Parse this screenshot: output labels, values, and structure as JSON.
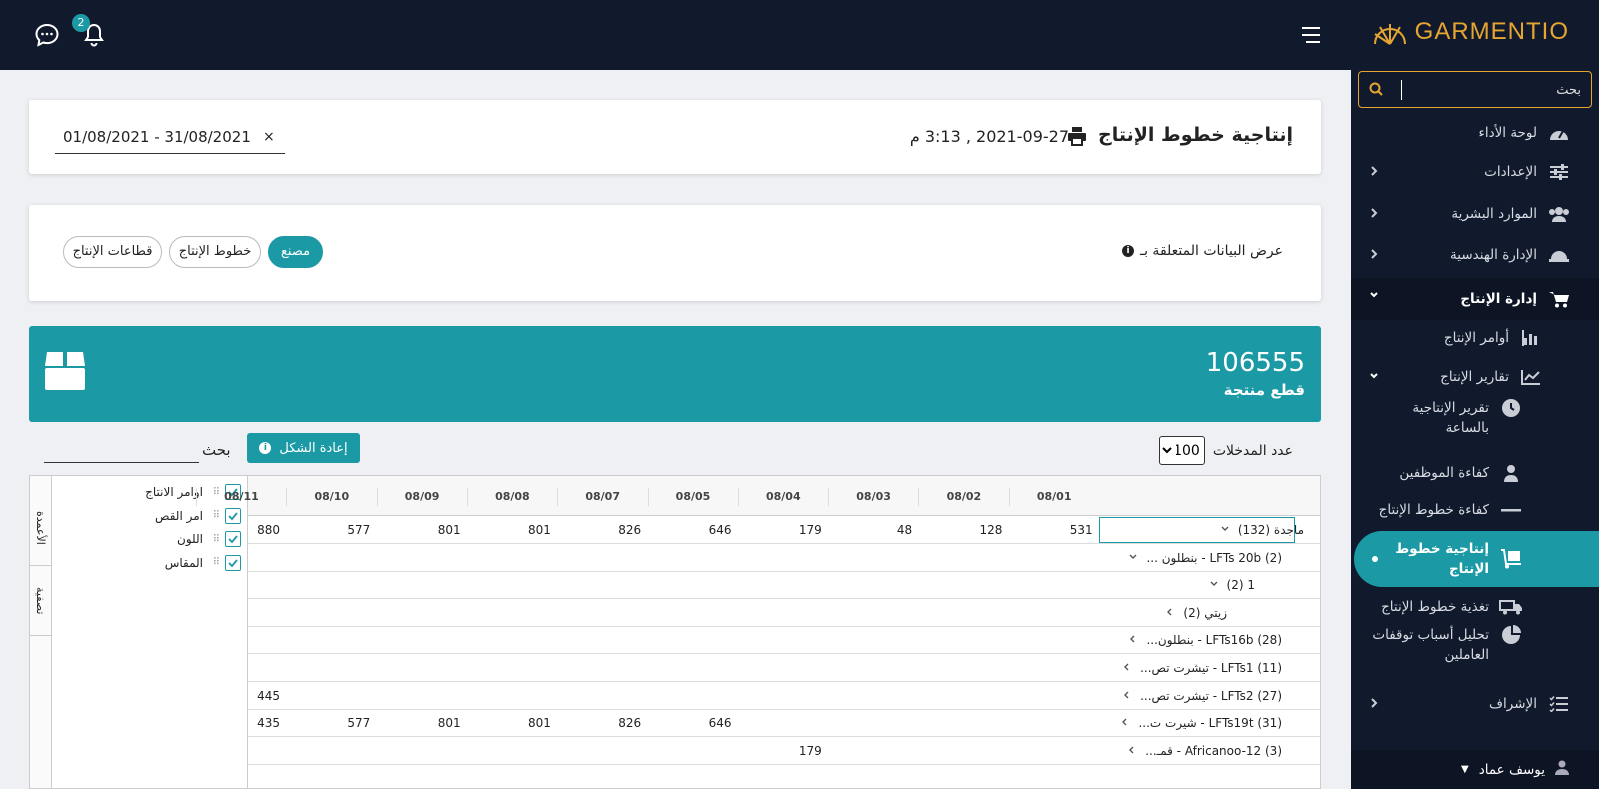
{
  "header": {
    "notification_count": "2"
  },
  "brand": {
    "name": "GARMENTIO"
  },
  "sidebar": {
    "search_placeholder": "بحث",
    "items": [
      {
        "label": "لوحة الأداء",
        "icon": "gauge-icon"
      },
      {
        "label": "الإعدادات",
        "icon": "sliders-icon"
      },
      {
        "label": "الموارد البشرية",
        "icon": "users-icon"
      },
      {
        "label": "الإدارة الهندسية",
        "icon": "hardhat-icon"
      },
      {
        "label": "إدارة الإنتاج",
        "icon": "cart-icon"
      },
      {
        "label": "أوامر الإنتاج",
        "icon": "bar-chart-icon"
      },
      {
        "label": "تقارير الإنتاج",
        "icon": "line-chart-icon"
      },
      {
        "label": "تقرير الإنتاجية بالساعة",
        "icon": "clock-icon"
      },
      {
        "label": "كفاءة الموظفين",
        "icon": "user-icon"
      },
      {
        "label": "كفاءة خطوط الإنتاج",
        "icon": "line-icon"
      },
      {
        "label": "إنتاجية خطوط الإنتاج",
        "icon": "dolly-icon"
      },
      {
        "label": "تغذية خطوط الإنتاج",
        "icon": "truck-icon"
      },
      {
        "label": "تحليل أسباب توقفات العاملين",
        "icon": "pie-icon"
      },
      {
        "label": "الإشراف",
        "icon": "list-check-icon"
      }
    ],
    "user_name": "يوسف عماد"
  },
  "page": {
    "title": "إنتاجية خطوط الإنتاج",
    "date": "2021-09-27 , 3:13 م",
    "date_range": "01/08/2021   -   31/08/2021",
    "date_clear": "×"
  },
  "filter": {
    "label": "عرض البيانات المتعلقة بـ",
    "options": [
      "مصنع",
      "خطوط الإنتاج",
      "قطاعات الإنتاج"
    ],
    "selected": "مصنع"
  },
  "stat": {
    "value": "106555",
    "label": "قطع منتجة"
  },
  "grid_toolbar": {
    "entries_label": "عدد المدخلات",
    "entries_value": "100",
    "reset_label": "إعادة الشكل",
    "search_label": "بحث"
  },
  "grid": {
    "side_tabs": [
      "الأعمدة",
      "تصفية"
    ],
    "column_items": [
      "اوامر الانتاج",
      "امر القص",
      "اللون",
      "المقاس"
    ],
    "date_headers": [
      "08/01",
      "08/02",
      "08/03",
      "08/04",
      "08/05",
      "08/07",
      "08/08",
      "08/09",
      "08/10",
      "08/11"
    ],
    "rows": [
      {
        "label": "ماجدة (132)",
        "values": [
          "531",
          "128",
          "48",
          "179",
          "646",
          "826",
          "801",
          "801",
          "577",
          "880"
        ]
      },
      {
        "label": "(2)  LFTs 20b - بنطلون ...",
        "values": [
          "",
          "",
          "",
          "",
          "",
          "",
          "",
          "",
          "",
          ""
        ]
      },
      {
        "label": "1 (2)",
        "values": [
          "",
          "",
          "",
          "",
          "",
          "",
          "",
          "",
          "",
          ""
        ]
      },
      {
        "label": "زيتي (2)",
        "values": [
          "",
          "",
          "",
          "",
          "",
          "",
          "",
          "",
          "",
          ""
        ]
      },
      {
        "label": "(28)  LFTs16b - بنطلون...",
        "values": [
          "",
          "",
          "",
          "",
          "",
          "",
          "",
          "",
          "",
          ""
        ]
      },
      {
        "label": "(11)  LFTs1 - تيشرت تص...",
        "values": [
          "",
          "",
          "",
          "",
          "",
          "",
          "",
          "",
          "",
          ""
        ]
      },
      {
        "label": "(27)  LFTs2 - تيشرت تص...",
        "values": [
          "",
          "",
          "",
          "",
          "",
          "",
          "",
          "",
          "",
          "445"
        ]
      },
      {
        "label": "(31)  LFTs19t - شيرت ت...",
        "values": [
          "",
          "",
          "",
          "",
          "646",
          "826",
          "801",
          "801",
          "577",
          "435"
        ]
      },
      {
        "label": "(3)  Africanoo-12 - قمـ...",
        "values": [
          "",
          "",
          "",
          "179",
          "",
          "",
          "",
          "",
          "",
          ""
        ]
      }
    ]
  },
  "colors": {
    "accent": "#1b9aa5",
    "nav_bg": "#111a2c",
    "brand": "#e6a531"
  }
}
